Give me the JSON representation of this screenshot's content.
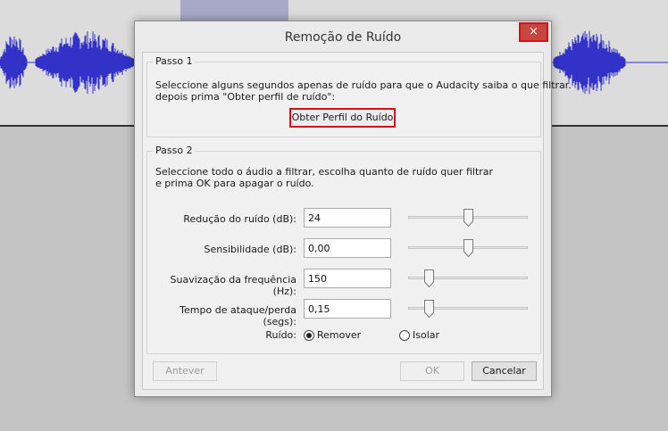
{
  "dialog": {
    "title": "Remoção de Ruído",
    "close_label": "×"
  },
  "step1": {
    "legend": "Passo 1",
    "line1": "Seleccione alguns segundos apenas de ruído para que o Audacity saiba o que filtrar.",
    "line2": "depois prima \"Obter perfil de ruído\":",
    "get_profile_label": "Obter Perfil do Ruído"
  },
  "step2": {
    "legend": "Passo 2",
    "line1": "Seleccione todo o áudio a filtrar, escolha quanto de ruído quer filtrar",
    "line2": "e prima OK para apagar o ruído.",
    "params": [
      {
        "label": "Redução do ruído (dB):",
        "value": "24",
        "slider_fraction": 0.5
      },
      {
        "label": "Sensibilidade (dB):",
        "value": "0,00",
        "slider_fraction": 0.5
      },
      {
        "label": "Suavização da frequência (Hz):",
        "value": "150",
        "slider_fraction": 0.15
      },
      {
        "label": "Tempo de ataque/perda (segs):",
        "value": "0,15",
        "slider_fraction": 0.15
      }
    ],
    "noise_label": "Ruído:",
    "noise_options": [
      {
        "label": "Remover",
        "checked": true
      },
      {
        "label": "Isolar",
        "checked": false
      }
    ]
  },
  "buttons": {
    "preview": "Antever",
    "ok": "OK",
    "cancel": "Cancelar"
  },
  "colors": {
    "waveform": "#3232c8",
    "highlight_border": "#d40f1d",
    "close_button": "#c7463f"
  }
}
